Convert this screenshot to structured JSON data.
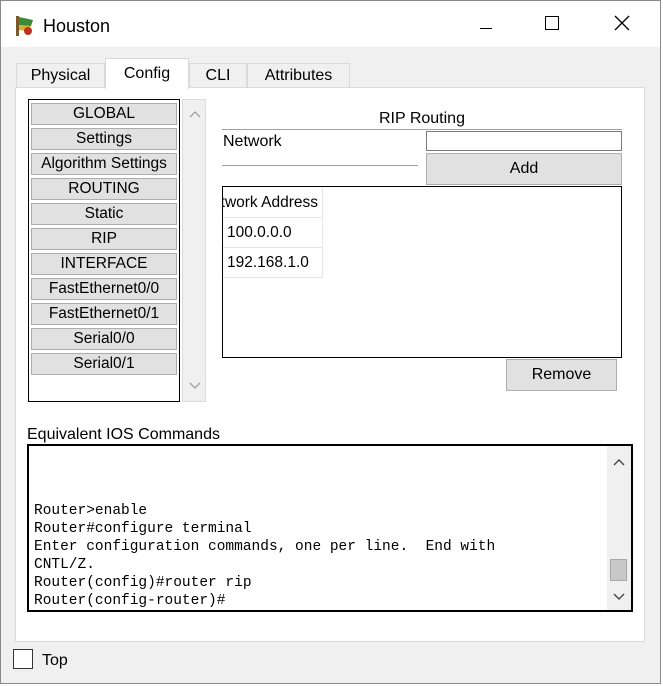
{
  "window": {
    "title": "Houston",
    "app_icon": "router-device-icon",
    "controls": {
      "minimize": "minimize-icon",
      "maximize": "maximize-icon",
      "close": "close-icon"
    }
  },
  "tabs": [
    {
      "label": "Physical",
      "active": false
    },
    {
      "label": "Config",
      "active": true
    },
    {
      "label": "CLI",
      "active": false
    },
    {
      "label": "Attributes",
      "active": false
    }
  ],
  "sidebar": {
    "items": [
      {
        "label": "GLOBAL"
      },
      {
        "label": "Settings"
      },
      {
        "label": "Algorithm Settings"
      },
      {
        "label": "ROUTING"
      },
      {
        "label": "Static"
      },
      {
        "label": "RIP"
      },
      {
        "label": "INTERFACE"
      },
      {
        "label": "FastEthernet0/0"
      },
      {
        "label": "FastEthernet0/1"
      },
      {
        "label": "Serial0/0"
      },
      {
        "label": "Serial0/1"
      }
    ]
  },
  "rip": {
    "title": "RIP Routing",
    "network_label": "Network",
    "network_value": "",
    "add_label": "Add",
    "remove_label": "Remove",
    "table": {
      "header": "Network Address",
      "rows": [
        "100.0.0.0",
        "192.168.1.0"
      ]
    }
  },
  "ios": {
    "label": "Equivalent IOS Commands",
    "lines": [
      "Router>enable",
      "Router#configure terminal",
      "Enter configuration commands, one per line.  End with",
      "CNTL/Z.",
      "Router(config)#router rip",
      "Router(config-router)#"
    ]
  },
  "footer": {
    "top_label": "Top",
    "top_checked": false
  }
}
